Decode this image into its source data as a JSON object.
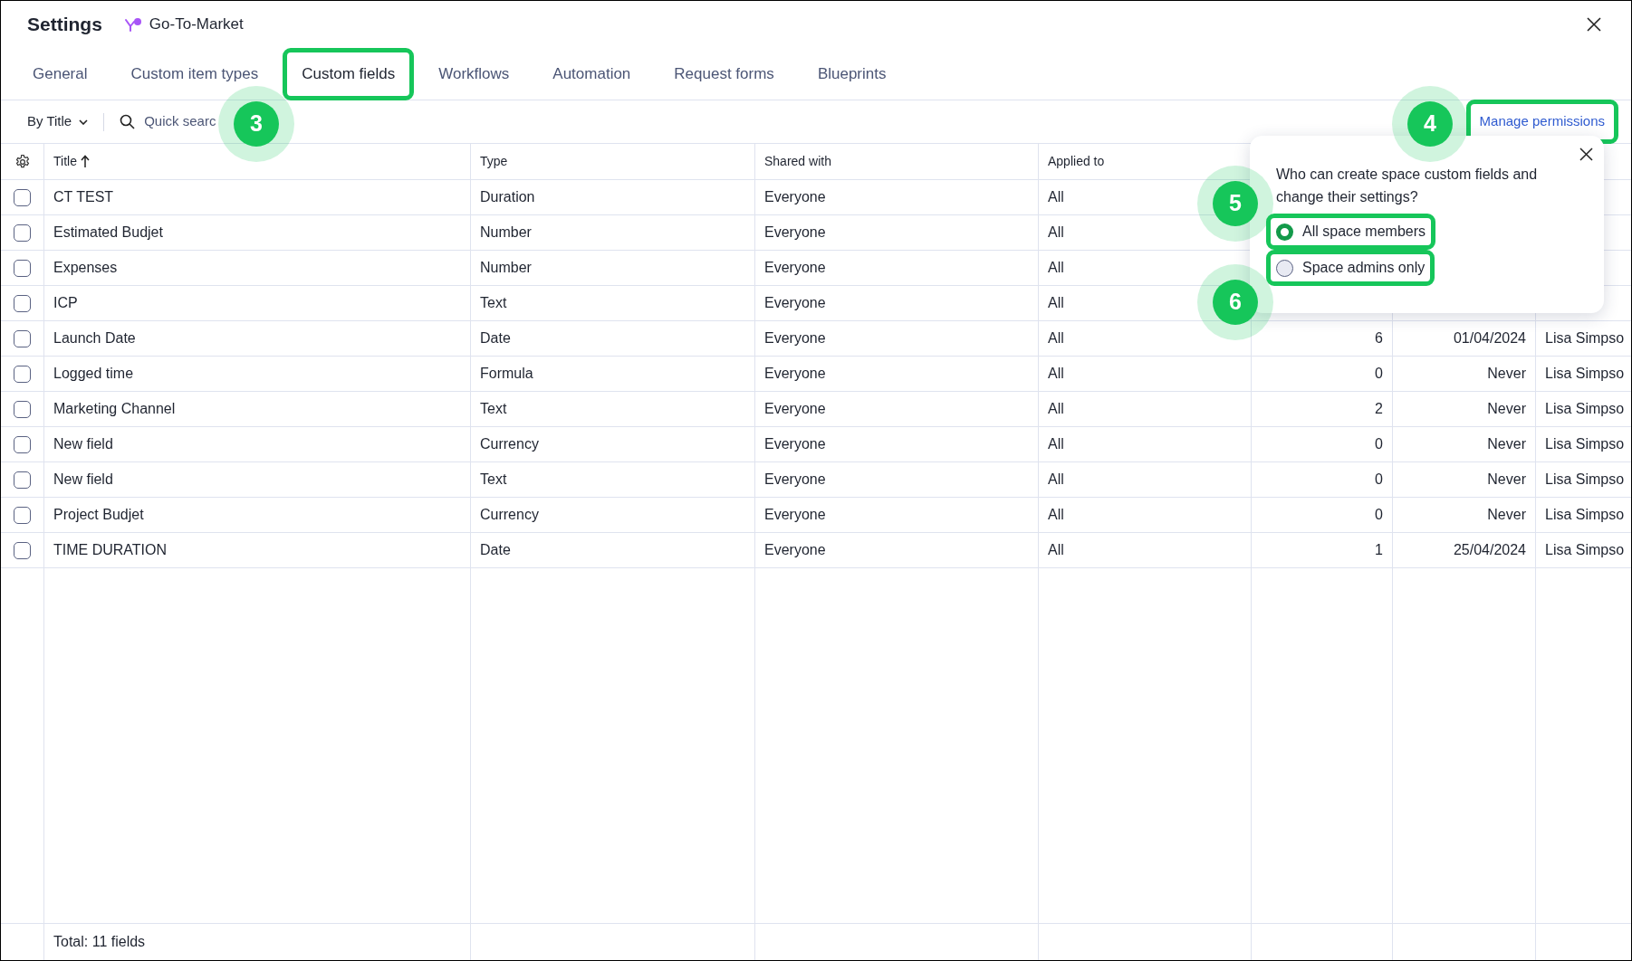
{
  "window": {
    "title": "Settings",
    "space": "Go-To-Market"
  },
  "tabs": [
    {
      "label": "General",
      "selected": false,
      "highlighted": false
    },
    {
      "label": "Custom item types",
      "selected": false,
      "highlighted": false
    },
    {
      "label": "Custom fields",
      "selected": true,
      "highlighted": true
    },
    {
      "label": "Workflows",
      "selected": false,
      "highlighted": false
    },
    {
      "label": "Automation",
      "selected": false,
      "highlighted": false
    },
    {
      "label": "Request forms",
      "selected": false,
      "highlighted": false
    },
    {
      "label": "Blueprints",
      "selected": false,
      "highlighted": false
    }
  ],
  "toolbar": {
    "sort": "By Title",
    "search_placeholder": "Quick searc",
    "manage_permissions": {
      "label": "Manage permissions",
      "highlighted": true
    }
  },
  "table": {
    "columns": [
      "Title",
      "Type",
      "Shared with",
      "Applied to"
    ],
    "rows": [
      {
        "checked": false,
        "cells": [
          "CT TEST",
          "Duration",
          "Everyone",
          "All"
        ]
      },
      {
        "checked": false,
        "cells": [
          "Estimated Budjet",
          "Number",
          "Everyone",
          "All"
        ]
      },
      {
        "checked": false,
        "cells": [
          "Expenses",
          "Number",
          "Everyone",
          "All"
        ]
      },
      {
        "checked": false,
        "cells": [
          "ICP",
          "Text",
          "Everyone",
          "All"
        ]
      },
      {
        "checked": false,
        "cells": [
          "Launch Date",
          "Date",
          "Everyone",
          "All",
          "6",
          "01/04/2024",
          "Lisa Simpso"
        ]
      },
      {
        "checked": false,
        "cells": [
          "Logged time",
          "Formula",
          "Everyone",
          "All",
          "0",
          "Never",
          "Lisa Simpso"
        ]
      },
      {
        "checked": false,
        "cells": [
          "Marketing Channel",
          "Text",
          "Everyone",
          "All",
          "2",
          "Never",
          "Lisa Simpso"
        ]
      },
      {
        "checked": false,
        "cells": [
          "New field",
          "Currency",
          "Everyone",
          "All",
          "0",
          "Never",
          "Lisa Simpso"
        ]
      },
      {
        "checked": false,
        "cells": [
          "New field",
          "Text",
          "Everyone",
          "All",
          "0",
          "Never",
          "Lisa Simpso"
        ]
      },
      {
        "checked": false,
        "cells": [
          "Project Budjet",
          "Currency",
          "Everyone",
          "All",
          "0",
          "Never",
          "Lisa Simpso"
        ]
      },
      {
        "checked": false,
        "cells": [
          "TIME DURATION",
          "Date",
          "Everyone",
          "All",
          "1",
          "25/04/2024",
          "Lisa Simpso"
        ]
      }
    ],
    "footer": "Total: 11 fields"
  },
  "popover": {
    "question": "Who can create space custom fields and change their settings?",
    "options": [
      {
        "label": "All space members",
        "selected": true,
        "highlighted": true
      },
      {
        "label": "Space admins only",
        "selected": false,
        "highlighted": true
      }
    ]
  },
  "callouts": [
    "3",
    "4",
    "5",
    "6"
  ]
}
